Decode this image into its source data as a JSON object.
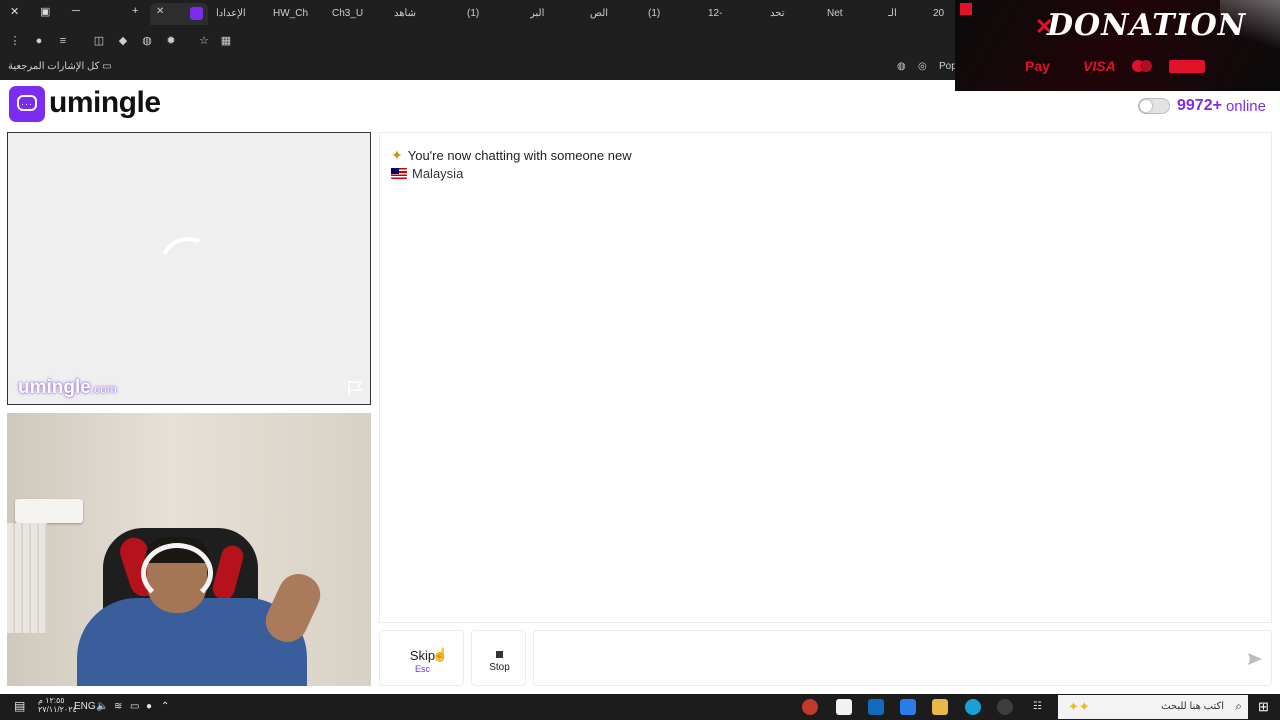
{
  "browser": {
    "tabs": [
      "الإعدادا",
      "HW_Ch",
      "Ch3_U",
      "شاهد",
      "(1)",
      "البر",
      "الص",
      "(1)",
      "12-",
      "تحد",
      "Net",
      "الـ",
      "20"
    ],
    "bookmarks_label": "كل الإشارات المرجعية",
    "popup_label": "Popu"
  },
  "donation": {
    "title": "DONATION",
    "payments": [
      "Pay",
      "VISA"
    ]
  },
  "app": {
    "logo_text": "umingle",
    "online_count": "9972+",
    "online_label": "online"
  },
  "remote_video": {
    "watermark": "umingle",
    "watermark_suffix": ".com",
    "report_icon": "flag-icon"
  },
  "chat": {
    "system_message": "You're now chatting with someone new",
    "country": "Malaysia"
  },
  "controls": {
    "skip_label": "Skip",
    "skip_key": "Esc",
    "stop_label": "Stop",
    "message_placeholder": "",
    "send_icon": "send-icon"
  },
  "taskbar": {
    "search_placeholder": "اكتب هنا للبحث",
    "language": "ENG",
    "time": "١٢:٥٥ م",
    "date": "٢٧/١١/٢٠٢٤"
  },
  "colors": {
    "brand": "#7b2cf0",
    "chrome": "#1f1f1f",
    "taskbar": "#1c1c1c"
  }
}
